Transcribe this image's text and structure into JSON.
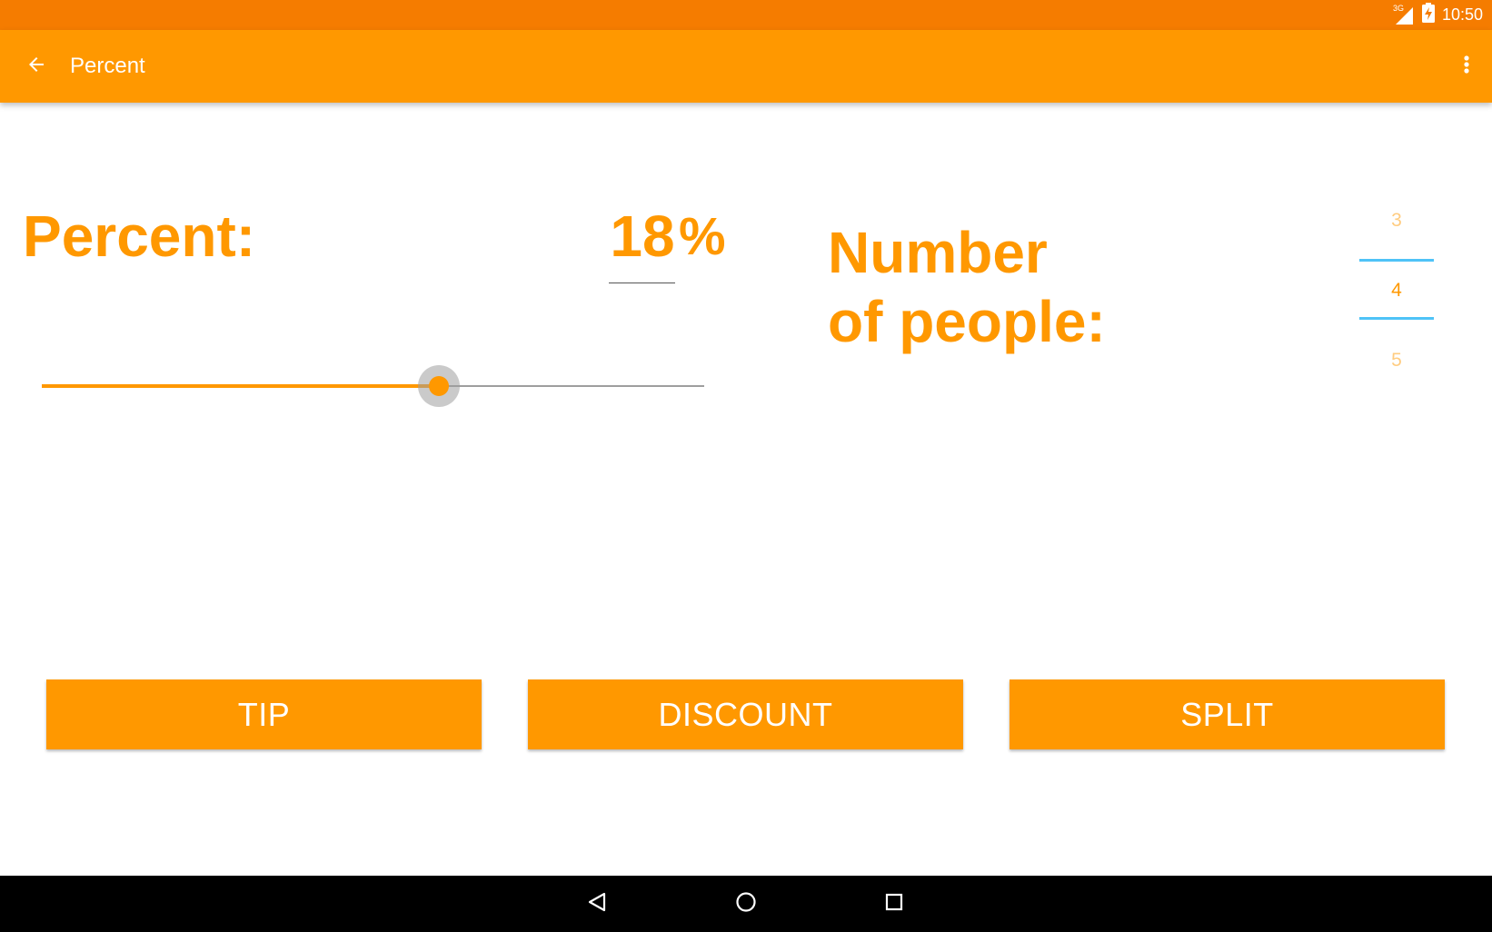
{
  "status_bar": {
    "time": "10:50",
    "network_label": "3G",
    "icons": [
      "signal-icon",
      "battery-charging-icon"
    ]
  },
  "app_bar": {
    "title": "Percent",
    "back_icon": "arrow-back-icon",
    "menu_icon": "more-vert-icon"
  },
  "percent": {
    "label": "Percent:",
    "value": "18",
    "unit": "%",
    "slider_fraction": 0.6
  },
  "people": {
    "label_line1": "Number",
    "label_line2": "of people:",
    "picker": {
      "previous": "3",
      "current": "4",
      "next": "5"
    }
  },
  "buttons": {
    "tip": "TIP",
    "discount": "DISCOUNT",
    "split": "SPLIT"
  },
  "nav_bar": {
    "icons": [
      "back-triangle-icon",
      "home-circle-icon",
      "recents-square-icon"
    ]
  },
  "colors": {
    "primary": "#ff9800",
    "primary_dark": "#f57c00",
    "picker_divider": "#4fc3f7",
    "picker_faded": "#ffcc80"
  }
}
